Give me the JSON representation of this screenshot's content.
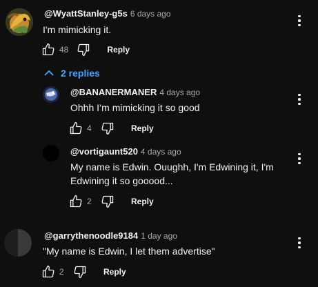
{
  "comments": [
    {
      "author": "@WyattStanley-g5s",
      "time": "6 days ago",
      "text": "I'm mimicking it.",
      "likes": "48",
      "reply_label": "Reply",
      "avatar_style": "lizard"
    },
    {
      "author": "@garrythenoodle9184",
      "time": "1 day ago",
      "text": "\"My name is Edwin, I let them advertise\"",
      "likes": "2",
      "reply_label": "Reply",
      "avatar_style": "dark"
    }
  ],
  "replies_toggle": {
    "label": "2 replies"
  },
  "replies": [
    {
      "author": "@BANANERMANER",
      "time": "4 days ago",
      "text": "Ohhh I’m mimicking it so good",
      "likes": "4",
      "reply_label": "Reply",
      "avatar_style": "globe"
    },
    {
      "author": "@vortigaunt520",
      "time": "4 days ago",
      "text_line1": "My name is Edwin. Ouughh, I'm Edwining it, I'm",
      "text_line2": "Edwining it so gooood...",
      "likes": "2",
      "reply_label": "Reply",
      "avatar_style": "black"
    }
  ],
  "colors": {
    "background": "#0f0f0f",
    "text": "#f1f1f1",
    "secondary": "#aaaaaa",
    "link": "#3ea6ff"
  }
}
